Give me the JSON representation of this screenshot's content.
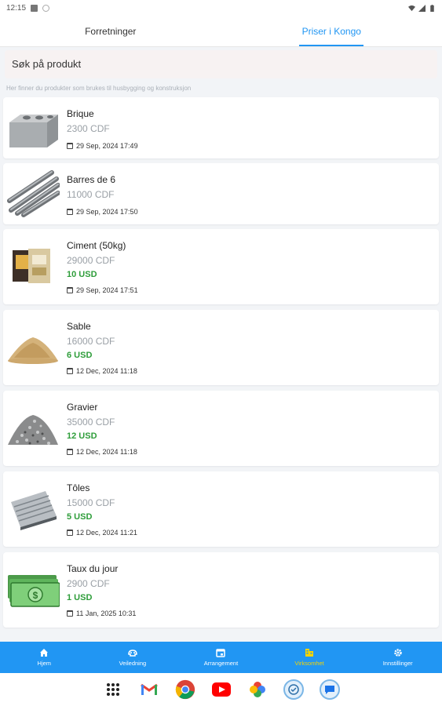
{
  "status": {
    "time": "12:15"
  },
  "tabs": [
    {
      "label": "Forretninger",
      "active": false
    },
    {
      "label": "Priser i Kongo",
      "active": true
    }
  ],
  "search": {
    "placeholder": "Søk på produkt"
  },
  "hint": "Her finner du produkter som brukes til husbygging og konstruksjon",
  "products": [
    {
      "name": "Brique",
      "cdf": "2300 CDF",
      "usd": "",
      "date": "29 Sep, 2024 17:49",
      "icon": "brick-image"
    },
    {
      "name": "Barres de 6",
      "cdf": "11000 CDF",
      "usd": "",
      "date": "29 Sep, 2024 17:50",
      "icon": "rebar-image"
    },
    {
      "name": "Ciment (50kg)",
      "cdf": "29000 CDF",
      "usd": "10 USD",
      "date": "29 Sep, 2024 17:51",
      "icon": "cement-bag-image"
    },
    {
      "name": "Sable",
      "cdf": "16000 CDF",
      "usd": "6 USD",
      "date": "12 Dec, 2024 11:18",
      "icon": "sand-pile-image"
    },
    {
      "name": "Gravier",
      "cdf": "35000 CDF",
      "usd": "12 USD",
      "date": "12 Dec, 2024 11:18",
      "icon": "gravel-pile-image"
    },
    {
      "name": "Tôles",
      "cdf": "15000 CDF",
      "usd": "5 USD",
      "date": "12 Dec, 2024 11:21",
      "icon": "metal-sheets-image"
    },
    {
      "name": "Taux du jour",
      "cdf": "2900 CDF",
      "usd": "1 USD",
      "date": "11 Jan, 2025 10:31",
      "icon": "banknotes-image"
    }
  ],
  "bottom_nav": [
    {
      "label": "Hjem",
      "icon": "home-icon",
      "active": false
    },
    {
      "label": "Veiledning",
      "icon": "guide-icon",
      "active": false
    },
    {
      "label": "Arrangement",
      "icon": "calendar-icon",
      "active": false
    },
    {
      "label": "Virksomhet",
      "icon": "business-icon",
      "active": true
    },
    {
      "label": "Innstillinger",
      "icon": "settings-icon",
      "active": false
    }
  ],
  "colors": {
    "primary": "#2196f3",
    "active_nav": "#f5d400",
    "usd_green": "#2e9d3a"
  }
}
